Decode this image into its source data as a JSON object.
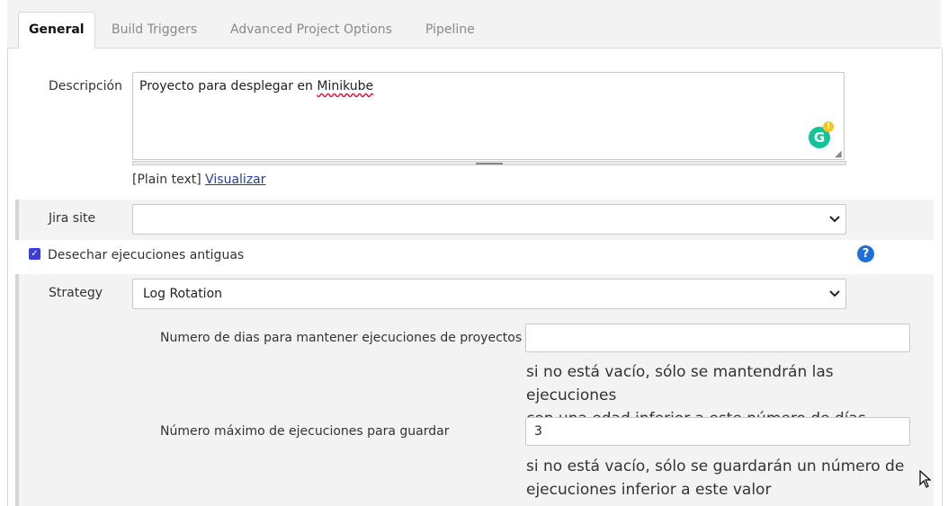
{
  "tabs": [
    {
      "label": "General",
      "active": true
    },
    {
      "label": "Build Triggers",
      "active": false
    },
    {
      "label": "Advanced Project Options",
      "active": false
    },
    {
      "label": "Pipeline",
      "active": false
    }
  ],
  "description": {
    "label": "Descripción",
    "value_prefix": "Proyecto para desplegar en ",
    "value_underlined": "Minikube",
    "format_text": "[Plain text]",
    "preview_link": "Visualizar"
  },
  "jira": {
    "label": "Jira site",
    "selected": ""
  },
  "discard_builds": {
    "label": "Desechar ejecuciones antiguas",
    "checked": true,
    "help": "?"
  },
  "strategy": {
    "label": "Strategy",
    "selected": "Log Rotation",
    "days_to_keep": {
      "label": "Numero de dias para mantener ejecuciones de proyectos",
      "value": "",
      "hint_line1": "si no está vacío, sólo se mantendrán las ejecuciones",
      "hint_line2": "con una edad inferior a este número de días"
    },
    "num_to_keep": {
      "label": "Número máximo de ejecuciones para guardar",
      "value": "3",
      "hint_line1": "si no está vacío, sólo se guardarán un número de",
      "hint_line2": "ejecuciones inferior a este valor"
    }
  },
  "icons": {
    "grammarly": "G",
    "grammarly_alert": "!",
    "chevron": "⌄",
    "cursor": "⇱"
  },
  "colors": {
    "accent_link": "#1f3ea8",
    "checkbox": "#3b3fd6",
    "help": "#1f6fd8",
    "grammarly": "#15c39a"
  }
}
